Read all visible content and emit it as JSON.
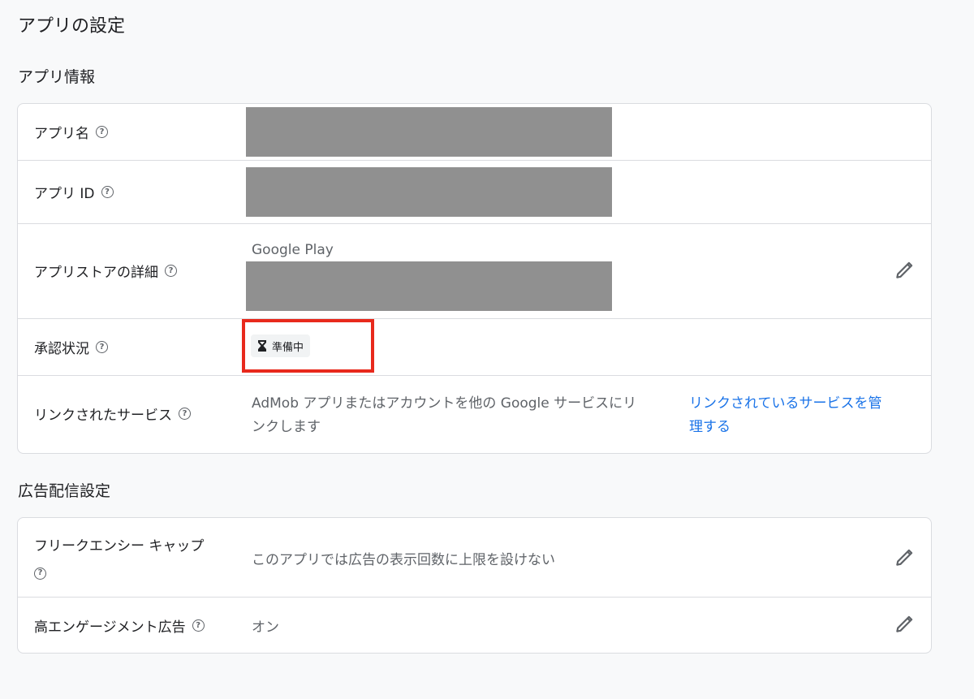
{
  "page": {
    "title": "アプリの設定"
  },
  "app_info": {
    "section_title": "アプリ情報",
    "app_name_label": "アプリ名",
    "app_id_label": "アプリ ID",
    "store_details_label": "アプリストアの詳細",
    "store_name": "Google Play",
    "approval_label": "承認状況",
    "approval_status": "準備中",
    "linked_services_label": "リンクされたサービス",
    "linked_services_desc_line1": "AdMob アプリまたはアカウントを他の Google サービスにリ",
    "linked_services_desc_line2": "ンクします",
    "linked_services_link_line1": "リンクされているサービスを管",
    "linked_services_link_line2": "理する"
  },
  "ad_delivery": {
    "section_title": "広告配信設定",
    "frequency_cap_label": "フリークエンシー キャップ",
    "frequency_cap_value": "このアプリでは広告の表示回数に上限を設けない",
    "high_engagement_label": "高エンゲージメント広告",
    "high_engagement_value": "オン"
  },
  "icons": {
    "help": "help-circle-icon",
    "edit": "pencil-icon",
    "status": "hourglass-icon"
  },
  "colors": {
    "link": "#1a73e8",
    "highlight": "#e8291c",
    "redacted": "#909090"
  }
}
